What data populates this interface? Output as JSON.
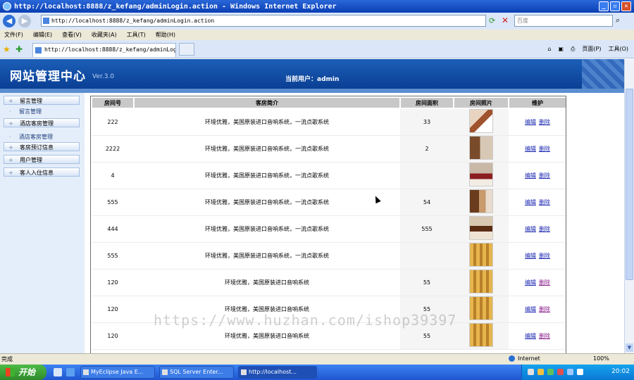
{
  "window": {
    "title": "http://localhost:8888/z_kefang/adminLogin.action - Windows Internet Explorer"
  },
  "browser": {
    "address": "http://localhost:8888/z_kefang/adminLogin.action",
    "search_placeholder": "百度",
    "tab_title": "http://localhost:8888/z_kefang/adminLogin...",
    "menu": [
      "文件(F)",
      "编辑(E)",
      "查看(V)",
      "收藏夹(A)",
      "工具(T)",
      "帮助(H)"
    ],
    "commands": [
      "页面(P)",
      "工具(O)"
    ]
  },
  "site": {
    "logo": "网站管理中心",
    "version": "Ver.3.0",
    "current_user": "当前用户：admin"
  },
  "sidebar": {
    "items": [
      {
        "label": "留言管理",
        "type": "main"
      },
      {
        "label": "留言管理",
        "type": "sub"
      },
      {
        "label": "酒店客房管理",
        "type": "main"
      },
      {
        "label": "酒店客房管理",
        "type": "sub"
      },
      {
        "label": "客房预订信息",
        "type": "main"
      },
      {
        "label": "用户管理",
        "type": "main"
      },
      {
        "label": "客人入住信息",
        "type": "main"
      }
    ]
  },
  "table": {
    "headers": [
      "房间号",
      "客房简介",
      "房间面积",
      "房间照片",
      "维护"
    ],
    "rows": [
      {
        "room": "222",
        "intro": "环境优雅，美国原装进口音响系统，一流点歌系统",
        "area": "33",
        "photo": "p1",
        "edit": "编辑",
        "delete": "删除"
      },
      {
        "room": "2222",
        "intro": "环境优雅，美国原装进口音响系统，一流点歌系统",
        "area": "2",
        "photo": "p2",
        "edit": "编辑",
        "delete": "删除"
      },
      {
        "room": "4",
        "intro": "环境优雅，美国原装进口音响系统，一流点歌系统",
        "area": "",
        "photo": "p3",
        "edit": "编辑",
        "delete": "删除"
      },
      {
        "room": "555",
        "intro": "环境优雅，美国原装进口音响系统，一流点歌系统",
        "area": "54",
        "photo": "p4",
        "edit": "编辑",
        "delete": "删除"
      },
      {
        "room": "444",
        "intro": "环境优雅，美国原装进口音响系统，一流点歌系统",
        "area": "555",
        "photo": "p5",
        "edit": "编辑",
        "delete": "删除"
      },
      {
        "room": "555",
        "intro": "环境优雅，美国原装进口音响系统，一流点歌系统",
        "area": "",
        "photo": "p6",
        "edit": "编辑",
        "delete": "删除"
      },
      {
        "room": "120",
        "intro": "环境优雅，美国原装进口音响系统",
        "area": "55",
        "photo": "p6",
        "edit": "编辑",
        "delete": "删除"
      },
      {
        "room": "120",
        "intro": "环境优雅，美国原装进口音响系统",
        "area": "55",
        "photo": "p6",
        "edit": "编辑",
        "delete": "删除"
      },
      {
        "room": "120",
        "intro": "环境优雅，美国原装进口音响系统",
        "area": "55",
        "photo": "p6",
        "edit": "编辑",
        "delete": "删除"
      }
    ]
  },
  "watermark": "https://www.huzhan.com/ishop39397",
  "status": {
    "text": "完成",
    "zone": "Internet",
    "zoom": "100%"
  },
  "taskbar": {
    "start": "开始",
    "tasks": [
      "MyEclipse Java E...",
      "SQL Server Enter...",
      "http://localhost..."
    ],
    "clock": "20:02"
  }
}
